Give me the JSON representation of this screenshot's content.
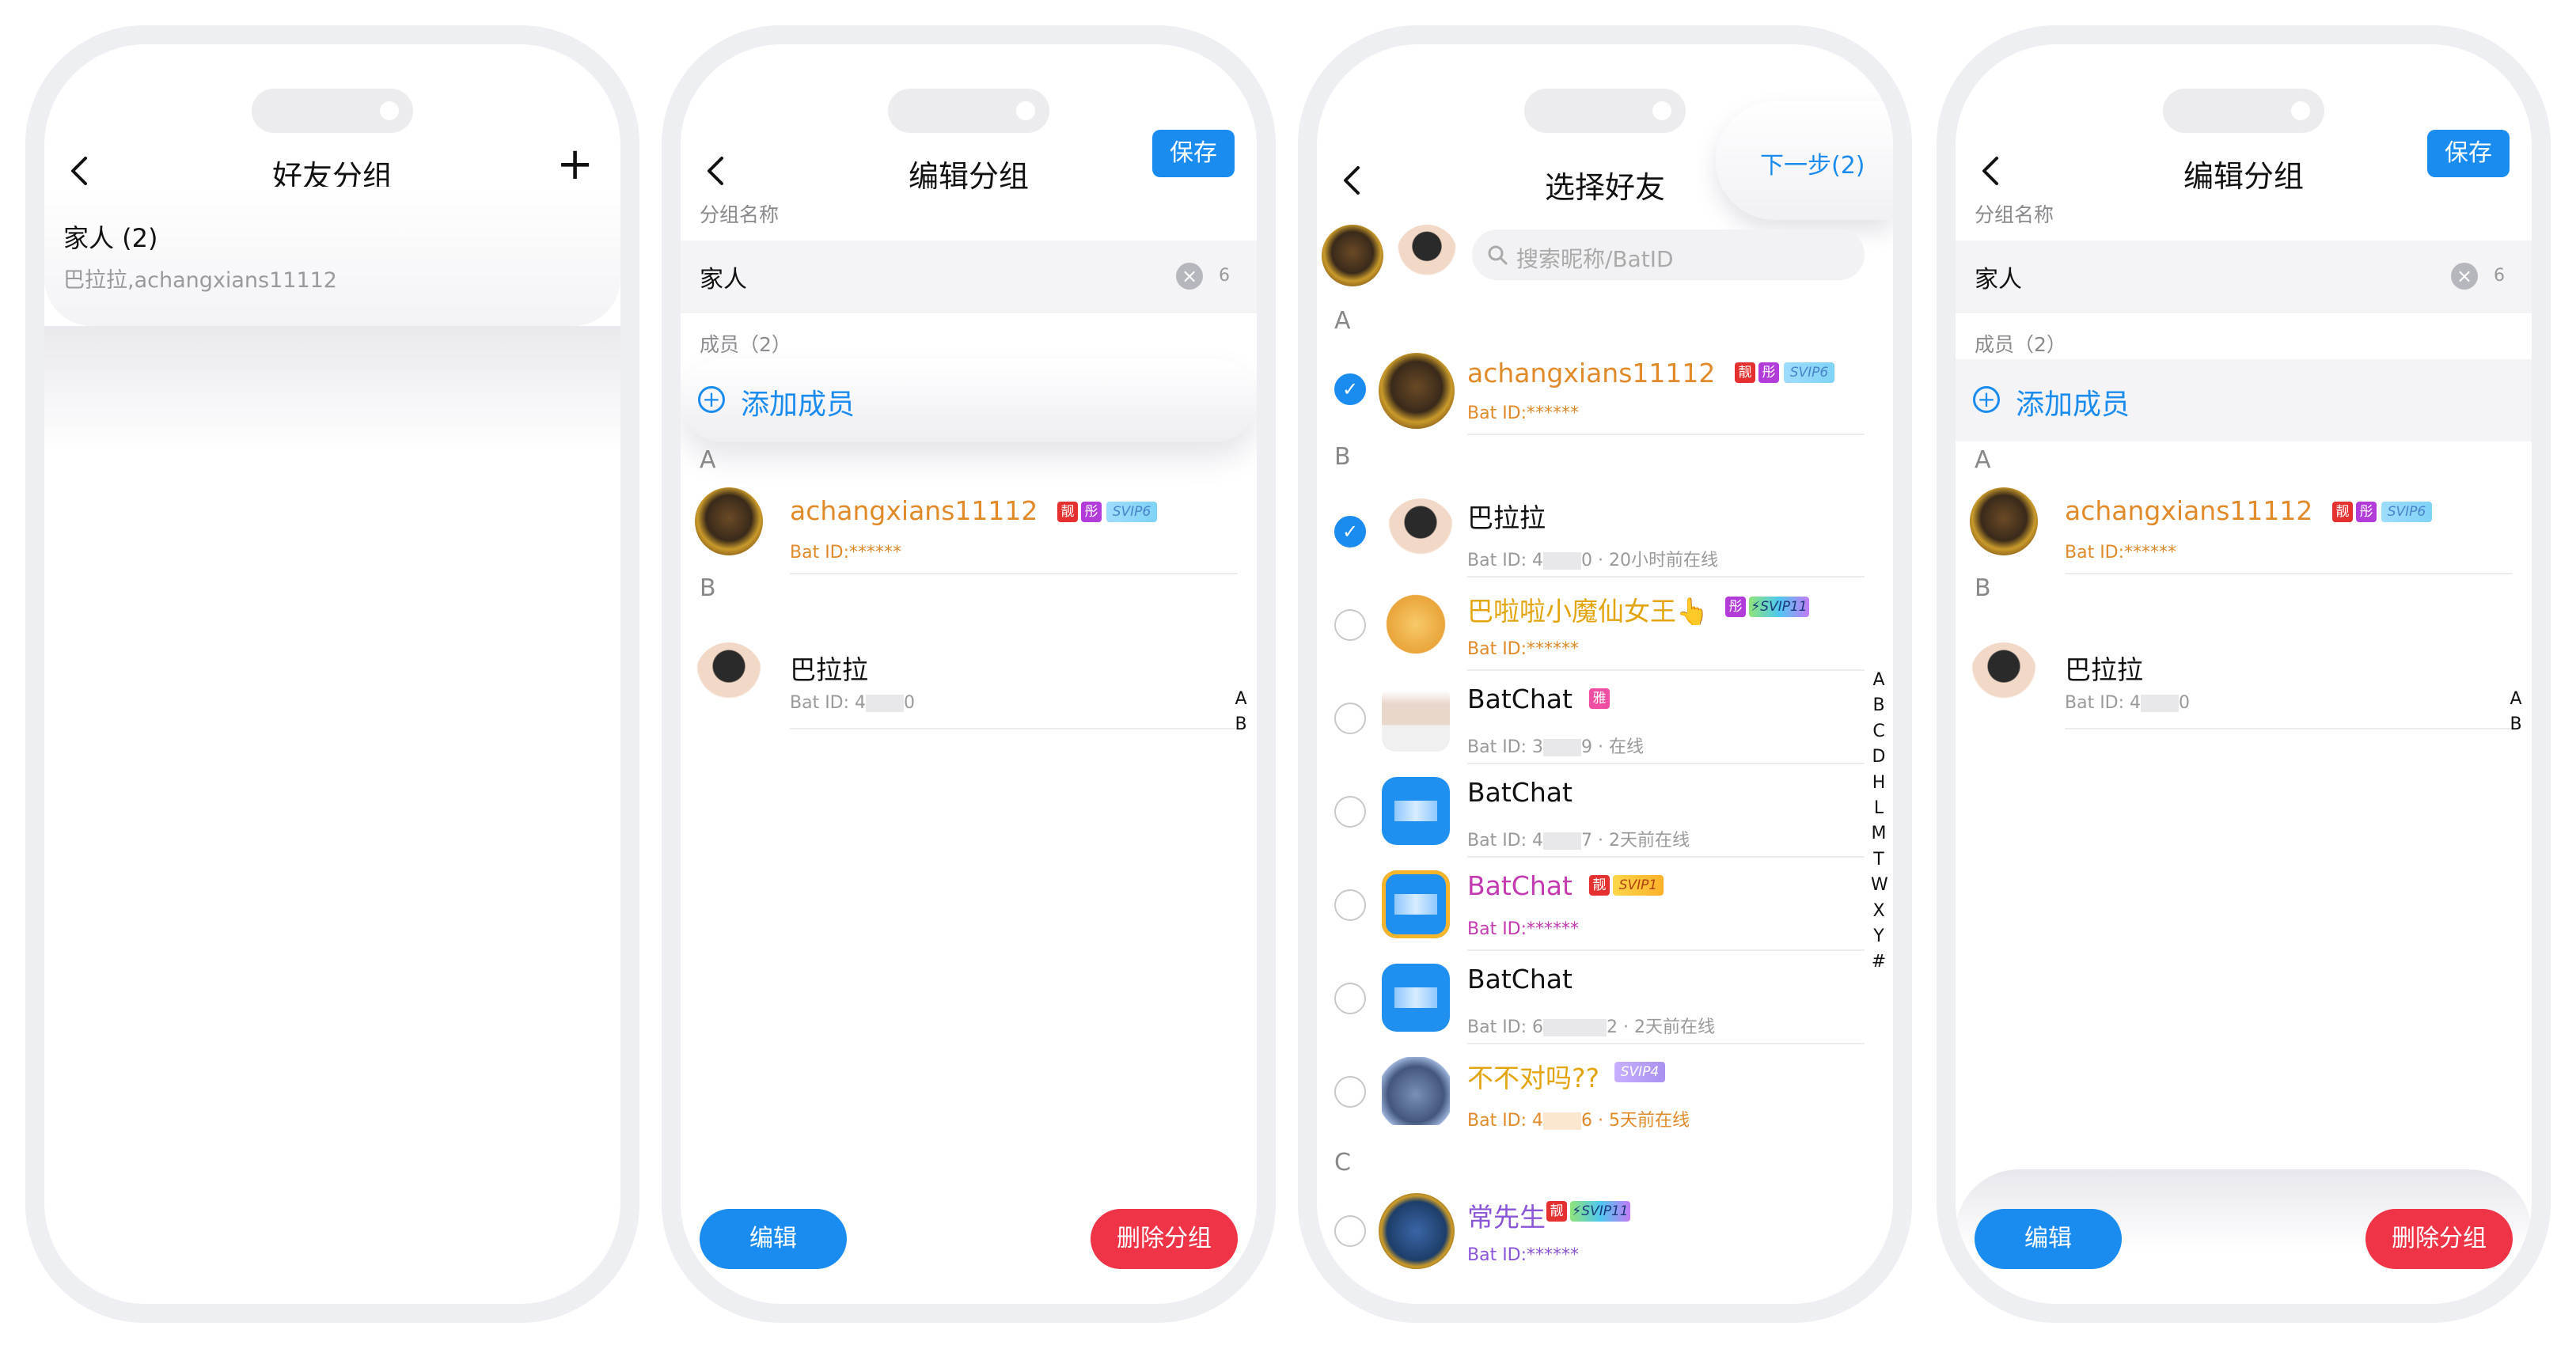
{
  "screens": {
    "groups": {
      "title": "好友分组",
      "add_symbol": "+",
      "group": {
        "name": "家人 (2)",
        "members": "巴拉拉,achangxians11112"
      }
    },
    "edit1": {
      "title": "编辑分组",
      "save": "保存",
      "name_label": "分组名称",
      "name_value": "家人",
      "name_count": "6",
      "members_label": "成员（2）",
      "add_member": "添加成员",
      "sections": [
        "A",
        "B"
      ],
      "members": [
        {
          "name": "achangxians11112",
          "badges": [
            "靓",
            "彤",
            "SVIP6"
          ],
          "id_prefix": "Bat ID:******"
        },
        {
          "name": "巴拉拉",
          "id_pre": "Bat ID: 4",
          "id_post": "0"
        }
      ],
      "index": [
        "A",
        "B"
      ],
      "edit_btn": "编辑",
      "delete_btn": "删除分组"
    },
    "select": {
      "title": "选择好友",
      "next": "下一步(2)",
      "search_placeholder": "搜索昵称/BatID",
      "sections": [
        "A",
        "B",
        "C"
      ],
      "friends": [
        {
          "name": "achangxians11112",
          "badges": [
            "靓",
            "彤",
            "SVIP6"
          ],
          "sub": "Bat ID:******",
          "checked": true
        },
        {
          "name": "巴拉拉",
          "sub_pre": "Bat ID: 4",
          "sub_post": "0 · 20小时前在线",
          "checked": true
        },
        {
          "name": "巴啦啦小魔仙女王👆",
          "badges": [
            "彤",
            "⚡SVIP11"
          ],
          "sub": "Bat ID:******",
          "checked": false
        },
        {
          "name": "BatChat",
          "badges": [
            "雅"
          ],
          "sub_pre": "Bat ID: 3",
          "sub_post": "9 · 在线",
          "checked": false
        },
        {
          "name": "BatChat",
          "sub_pre": "Bat ID: 4",
          "sub_post": "7 · 2天前在线",
          "checked": false
        },
        {
          "name": "BatChat",
          "badges": [
            "靓",
            "SVIP1"
          ],
          "sub": "Bat ID:******",
          "checked": false
        },
        {
          "name": "BatChat",
          "sub_pre": "Bat ID: 6",
          "sub_post": "2 · 2天前在线",
          "checked": false
        },
        {
          "name": "不不对吗??",
          "badges": [
            "SVIP4"
          ],
          "sub_pre": "Bat ID: 4",
          "sub_post": "6 · 5天前在线",
          "checked": false
        },
        {
          "name": "常先生",
          "badges": [
            "靓",
            "⚡SVIP11"
          ],
          "sub": "Bat ID:******",
          "checked": false
        }
      ],
      "index": [
        "A",
        "B",
        "C",
        "D",
        "H",
        "L",
        "M",
        "T",
        "W",
        "X",
        "Y",
        "#"
      ]
    },
    "edit2": {
      "title": "编辑分组",
      "save": "保存",
      "name_label": "分组名称",
      "name_value": "家人",
      "name_count": "6",
      "members_label": "成员（2）",
      "add_member": "添加成员",
      "sections": [
        "A",
        "B"
      ],
      "members": [
        {
          "name": "achangxians11112",
          "badges": [
            "靓",
            "彤",
            "SVIP6"
          ],
          "id_prefix": "Bat ID:******"
        },
        {
          "name": "巴拉拉",
          "id_pre": "Bat ID: 4",
          "id_post": "0"
        }
      ],
      "index": [
        "A",
        "B"
      ],
      "edit_btn": "编辑",
      "delete_btn": "删除分组"
    }
  },
  "colors": {
    "accent": "#1a8cf0",
    "danger": "#f03448",
    "frame": "#eeeff2"
  }
}
